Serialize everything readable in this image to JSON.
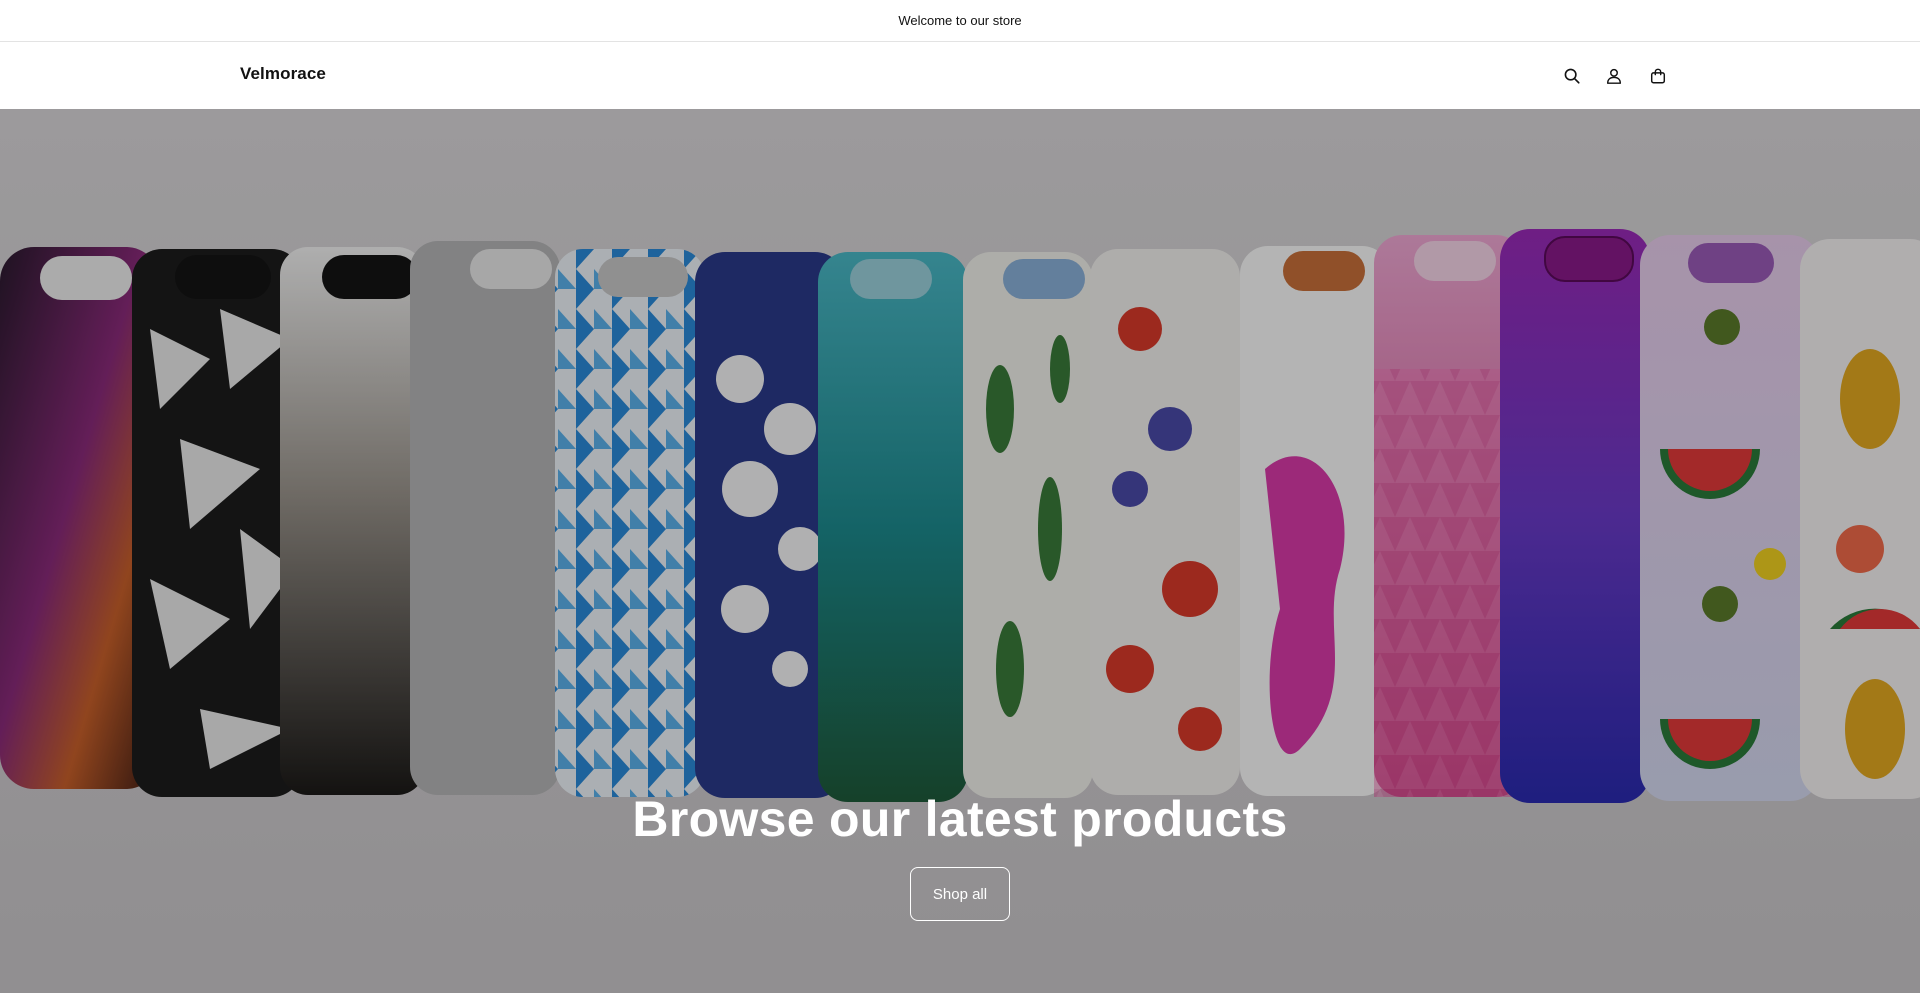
{
  "announcement": {
    "text": "Welcome to our store"
  },
  "header": {
    "logo": "Velmorace",
    "icons": [
      "search-icon",
      "account-icon",
      "cart-icon"
    ]
  },
  "hero": {
    "heading": "Browse our latest products",
    "button_label": "Shop all",
    "overlay_color": "#000000"
  }
}
